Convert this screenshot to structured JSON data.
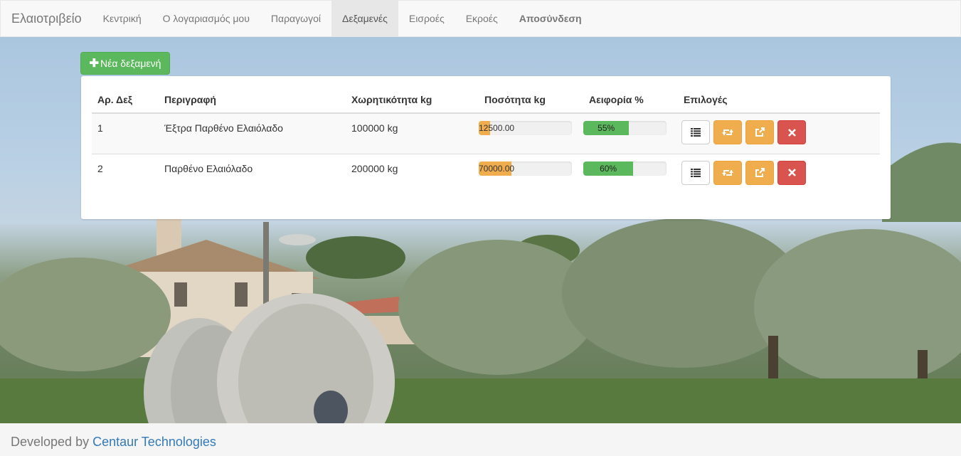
{
  "nav": {
    "brand": "Ελαιοτριβείο",
    "items": [
      {
        "label": "Κεντρική"
      },
      {
        "label": "Ο λογαριασμός μου"
      },
      {
        "label": "Παραγωγοί"
      },
      {
        "label": "Δεξαμενές"
      },
      {
        "label": "Εισροές"
      },
      {
        "label": "Εκροές"
      },
      {
        "label": "Αποσύνδεση"
      }
    ],
    "active": "Δεξαμενές"
  },
  "toolbar": {
    "new_label": "Νέα δεξαμενή",
    "new_icon": "plus-icon"
  },
  "table": {
    "headers": [
      "Αρ. Δεξ",
      "Περιγραφή",
      "Χωρητικότητα kg",
      "Ποσότητα kg",
      "Αειφορία %",
      "Επιλογές"
    ],
    "rows": [
      {
        "id": "1",
        "description": "Έξτρα Παρθένο Ελαιόλαδο",
        "capacity": "100000 kg",
        "quantity": "12500.00",
        "quantity_fraction": 0.125,
        "sustainability": "55%",
        "sustainability_fraction": 0.55
      },
      {
        "id": "2",
        "description": "Παρθένο Ελαιόλαδο",
        "capacity": "200000 kg",
        "quantity": "70000.00",
        "quantity_fraction": 0.35,
        "sustainability": "60%",
        "sustainability_fraction": 0.6
      }
    ],
    "action_icons": [
      "list-icon",
      "retweet-icon",
      "share-icon",
      "remove-icon"
    ]
  },
  "colors": {
    "success": "#5cb85c",
    "warning": "#f0ad4e",
    "danger": "#d9534f",
    "link": "#337ab7"
  },
  "footer": {
    "prefix": "Developed by",
    "link_text": "Centaur Technologies"
  }
}
